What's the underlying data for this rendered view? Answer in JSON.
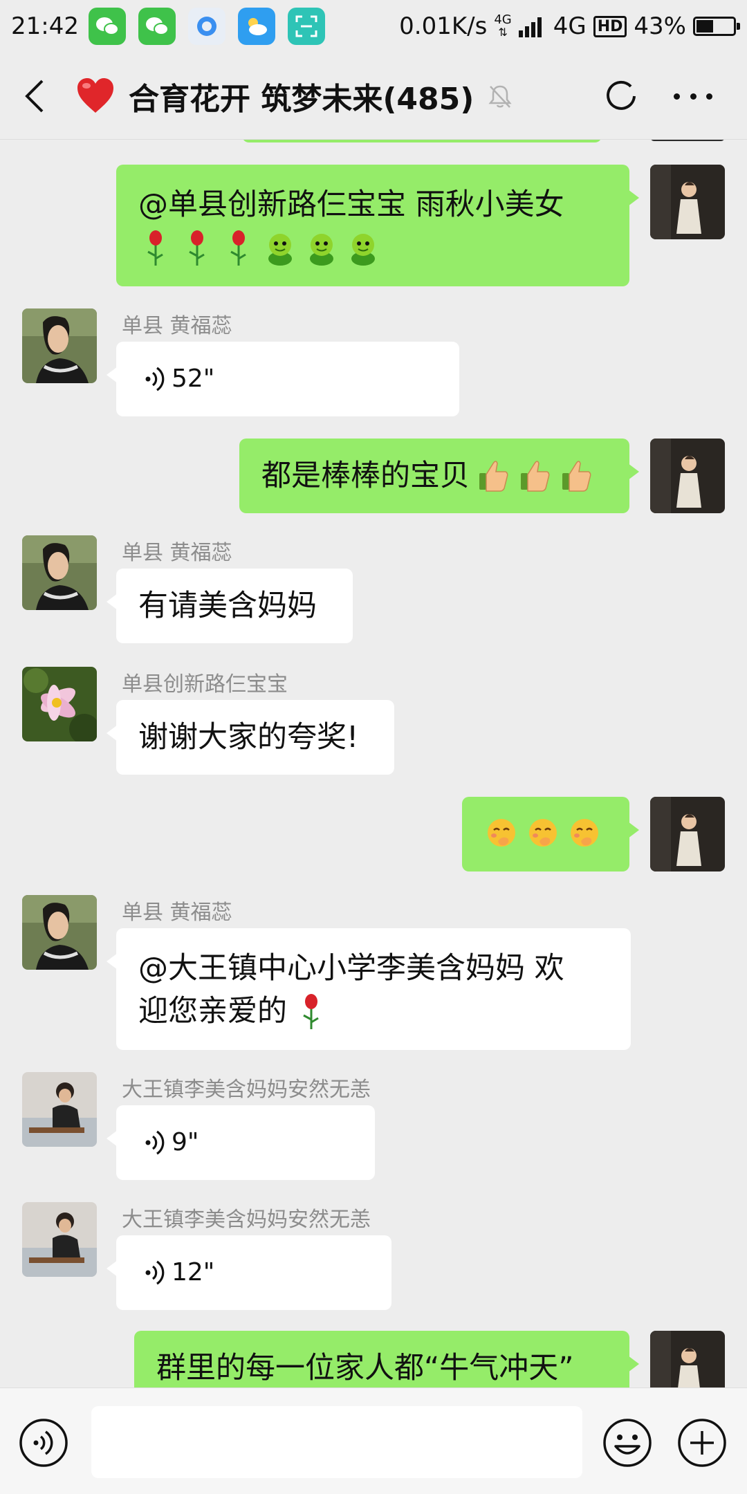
{
  "status_bar": {
    "time": "21:42",
    "net_speed": "0.01K/s",
    "network_small": "4G",
    "network": "4G",
    "hd": "HD",
    "battery": "43%"
  },
  "header": {
    "title": "合育花开 筑梦未来(485)"
  },
  "messages": [
    {
      "side": "right",
      "line1": "@单县创新路仨宝宝  雨秋小美女"
    },
    {
      "side": "left",
      "sender": "单县   黄福蕊",
      "voice": "52\""
    },
    {
      "side": "right",
      "text": "都是棒棒的宝贝"
    },
    {
      "side": "left",
      "sender": "单县   黄福蕊",
      "text": "有请美含妈妈"
    },
    {
      "side": "left",
      "sender": "单县创新路仨宝宝",
      "text": "谢谢大家的夸奖!"
    },
    {
      "side": "right"
    },
    {
      "side": "left",
      "sender": "单县   黄福蕊",
      "line1": "@大王镇中心小学李美含妈妈  欢",
      "line2": "迎您亲爱的"
    },
    {
      "side": "left",
      "sender": "大王镇李美含妈妈安然无恙",
      "voice": "9\""
    },
    {
      "side": "left",
      "sender": "大王镇李美含妈妈安然无恙",
      "voice": "12\""
    },
    {
      "side": "right",
      "text": "群里的每一位家人都“牛气冲天”"
    }
  ],
  "colors": {
    "my_bubble": "#95ec69",
    "their_bubble": "#ffffff",
    "background": "#ededed"
  }
}
